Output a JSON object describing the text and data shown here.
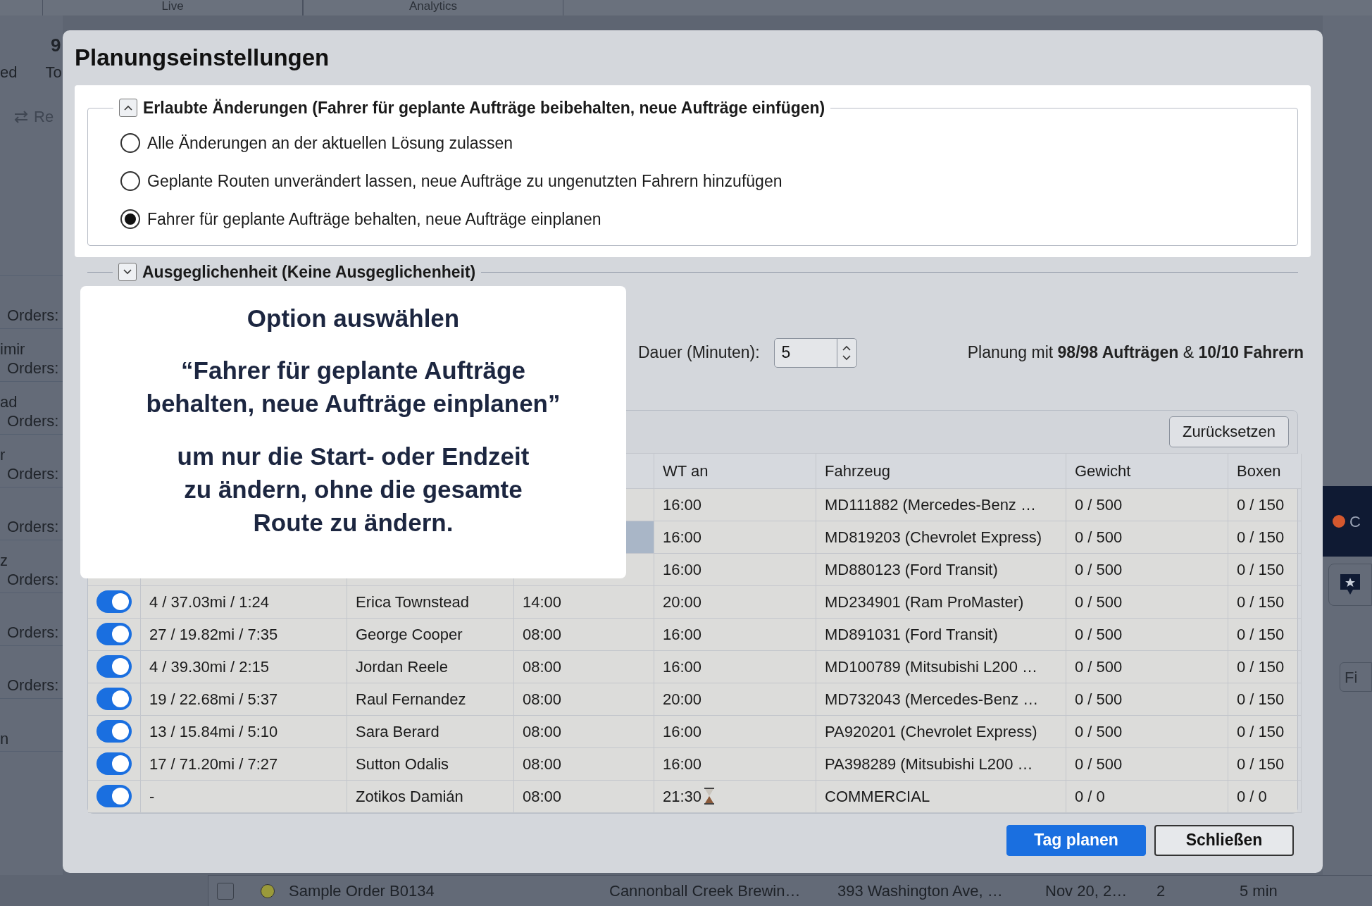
{
  "background": {
    "tabs": [
      {
        "label": "Live"
      },
      {
        "label": "Analytics"
      }
    ],
    "summary_value": "9",
    "summary_labels": [
      "ed",
      "To"
    ],
    "action": "Re",
    "drivers": [
      {
        "orders": "Orders:"
      },
      {
        "name": "imir",
        "orders": "Orders:"
      },
      {
        "name": "ad",
        "orders": "Orders:"
      },
      {
        "name": "r",
        "orders": "Orders:"
      },
      {
        "orders": "Orders:"
      },
      {
        "name": "z",
        "orders": "Orders:"
      },
      {
        "orders": "Orders:"
      },
      {
        "orders": "Orders:"
      },
      {
        "name": "n"
      }
    ],
    "right_panel": {
      "status": "C",
      "filter": "Fi"
    },
    "order_row": {
      "checked": false,
      "color": "#9a9a3a",
      "cells": [
        "Sample Order B0134",
        "Cannonball Creek Brewin…",
        "393 Washington Ave, …",
        "Nov 20, 2…",
        "2",
        "5 min"
      ]
    }
  },
  "dialog": {
    "title": "Planungseinstellungen",
    "sections": [
      {
        "legend": "Erlaubte Änderungen (Fahrer für geplante Aufträge beibehalten, neue Aufträge einfügen)",
        "expanded": true,
        "options": [
          {
            "label": "Alle Änderungen an der aktuellen Lösung zulassen",
            "selected": false
          },
          {
            "label": "Geplante Routen unverändert lassen, neue Aufträge zu ungenutzten Fahrern hinzufügen",
            "selected": false
          },
          {
            "label": "Fahrer für geplante Aufträge behalten, neue Aufträge einplanen",
            "selected": true
          }
        ]
      },
      {
        "legend": "Ausgeglichenheit (Keine Ausgeglichenheit)",
        "expanded": false
      }
    ],
    "duration": {
      "label": "Dauer (Minuten):",
      "value": "5"
    },
    "summary": "Planung mit **98/98 Aufträgen** & **10/10 Fahrern**",
    "reset_button": "Zurücksetzen",
    "table": {
      "columns": [
        "WT an",
        "Fahrzeug",
        "Gewicht",
        "Boxen"
      ],
      "rows": [
        {
          "highlighted": false,
          "wt_an": "16:00",
          "late": false,
          "fahrzeug": "MD111882 (Mercedes-Benz …",
          "gewicht": "0 / 500",
          "boxen": "0 / 150"
        },
        {
          "highlighted": true,
          "wt_an": "16:00",
          "late": false,
          "fahrzeug": "MD819203 (Chevrolet Express)",
          "gewicht": "0 / 500",
          "boxen": "0 / 150"
        },
        {
          "highlighted": false,
          "wt_an": "16:00",
          "late": false,
          "fahrzeug": "MD880123 (Ford Transit)",
          "gewicht": "0 / 500",
          "boxen": "0 / 150"
        },
        {
          "on": true,
          "highlighted": false,
          "column_2": "4 / 37.03mi / 1:24",
          "column_3": "Erica Townstead",
          "column_4": "14:00",
          "wt_an": "20:00",
          "late": false,
          "fahrzeug": "MD234901 (Ram ProMaster)",
          "gewicht": "0 / 500",
          "boxen": "0 / 150"
        },
        {
          "on": true,
          "highlighted": false,
          "column_2": "27 / 19.82mi / 7:35",
          "column_3": "George Cooper",
          "column_4": "08:00",
          "wt_an": "16:00",
          "late": false,
          "fahrzeug": "MD891031 (Ford Transit)",
          "gewicht": "0 / 500",
          "boxen": "0 / 150"
        },
        {
          "on": true,
          "highlighted": false,
          "column_2": "4 / 39.30mi / 2:15",
          "column_3": "Jordan Reele",
          "column_4": "08:00",
          "wt_an": "16:00",
          "late": false,
          "fahrzeug": "MD100789 (Mitsubishi L200 …",
          "gewicht": "0 / 500",
          "boxen": "0 / 150"
        },
        {
          "on": true,
          "highlighted": false,
          "column_2": "19 / 22.68mi / 5:37",
          "column_3": "Raul Fernandez",
          "column_4": "08:00",
          "wt_an": "20:00",
          "late": false,
          "fahrzeug": "MD732043 (Mercedes-Benz …",
          "gewicht": "0 / 500",
          "boxen": "0 / 150"
        },
        {
          "on": true,
          "highlighted": false,
          "column_2": "13 / 15.84mi / 5:10",
          "column_3": "Sara Berard",
          "column_4": "08:00",
          "wt_an": "16:00",
          "late": false,
          "fahrzeug": "PA920201 (Chevrolet Express)",
          "gewicht": "0 / 500",
          "boxen": "0 / 150"
        },
        {
          "on": true,
          "highlighted": false,
          "column_2": "17 / 71.20mi / 7:27",
          "column_3": "Sutton Odalis",
          "column_4": "08:00",
          "wt_an": "16:00",
          "late": false,
          "fahrzeug": "PA398289 (Mitsubishi L200 …",
          "gewicht": "0 / 500",
          "boxen": "0 / 150"
        },
        {
          "on": true,
          "highlighted": false,
          "column_2": "-",
          "column_3": "Zotikos Damián",
          "column_4": "08:00",
          "wt_an": "21:30",
          "late": true,
          "fahrzeug": "COMMERCIAL",
          "gewicht": "0 / 0",
          "boxen": "0 / 0"
        }
      ]
    },
    "buttons": [
      {
        "label": "Tag planen",
        "primary": true
      },
      {
        "label": "Schließen",
        "primary": false
      }
    ]
  },
  "callout": {
    "title": "Option auswählen",
    "quote": "“Fahrer für geplante Aufträge behalten, neue Aufträge einplanen”",
    "text": "um nur die Start- oder Endzeit zu ändern, ohne die gesamte Route zu ändern."
  }
}
